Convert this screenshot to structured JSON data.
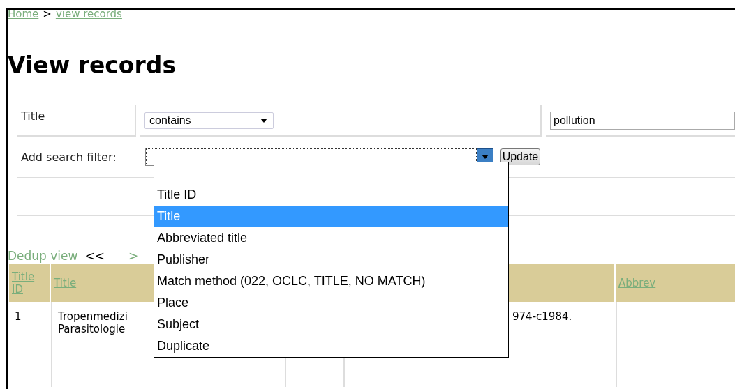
{
  "breadcrumb": [
    {
      "label": "Home"
    },
    {
      "label": "view records"
    }
  ],
  "breadcrumb_separator": ">",
  "heading": "View records",
  "filter": {
    "label": "Title",
    "operator": "contains",
    "value": "pollution"
  },
  "add_filter": {
    "label": "Add search filter:",
    "button": "Update",
    "dropdown_open": true,
    "options": [
      {
        "label": "Title ID",
        "selected": false
      },
      {
        "label": "Title",
        "selected": true
      },
      {
        "label": "Abbreviated title",
        "selected": false
      },
      {
        "label": "Publisher",
        "selected": false
      },
      {
        "label": "Match method (022, OCLC, TITLE, NO MATCH)",
        "selected": false
      },
      {
        "label": "Place",
        "selected": false
      },
      {
        "label": "Subject",
        "selected": false
      },
      {
        "label": "Duplicate",
        "selected": false
      }
    ]
  },
  "pager": {
    "link": "Dedup view",
    "prev": "<<",
    "next": ">"
  },
  "table": {
    "columns": [
      {
        "label": "Title ID"
      },
      {
        "label": "Title"
      },
      {},
      {},
      {
        "label": "Abbrev"
      }
    ],
    "rows": [
      {
        "cells": [
          [
            "1"
          ],
          [
            "Tropenmedizi",
            "Parasitologie"
          ],
          [],
          [
            "974-c1984."
          ],
          []
        ]
      }
    ]
  }
}
